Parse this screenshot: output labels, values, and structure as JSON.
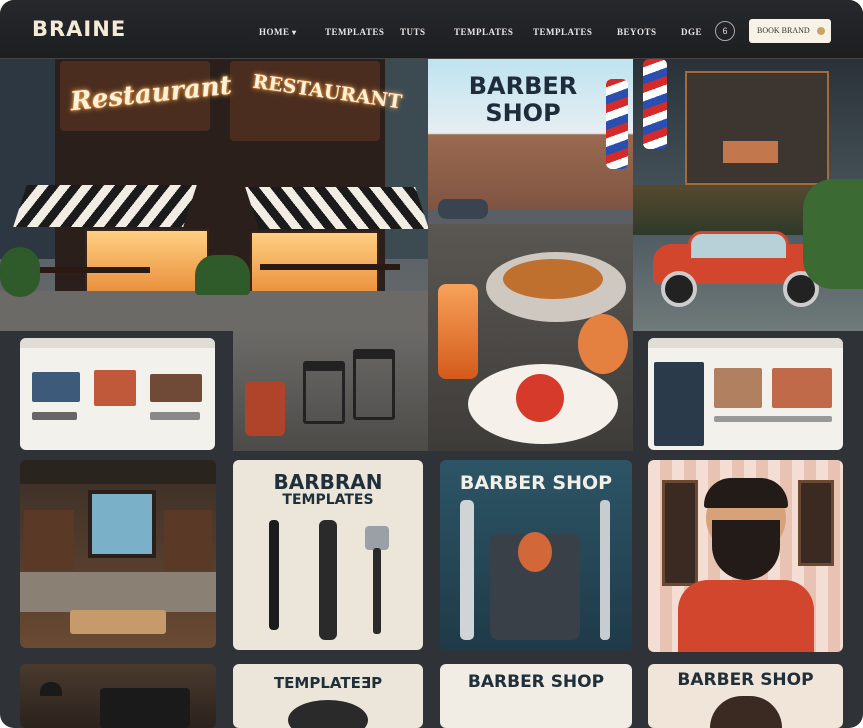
{
  "header": {
    "logo": "BRAINE",
    "nav": [
      "HOME",
      "TEMPLATES",
      "TUTS",
      "TEMPLATES",
      "TEMPLATES",
      "BEYOTS",
      "DGE"
    ],
    "circle_button": "6",
    "cta_label": "BOOK BRAND"
  },
  "hero": {
    "restaurant_sign_1": "Restaurant",
    "restaurant_sign_2": "RESTAURANT",
    "barber_title": "BARBER SHOP"
  },
  "grid": {
    "barbran_line1": "BARBRAN",
    "barbran_line2": "TEMPLATES",
    "barber_card_title": "BARBER SHOP",
    "templates_card_title": "TEMPLATEƎP",
    "barber_card_title_2": "BARBER SHOP",
    "barber_card_title_3": "BARBER SHOP"
  },
  "colors": {
    "cream": "#f7f1e6",
    "neon": "#ffb45c",
    "dark": "#1c1e20",
    "teal": "#2a5a6a"
  }
}
